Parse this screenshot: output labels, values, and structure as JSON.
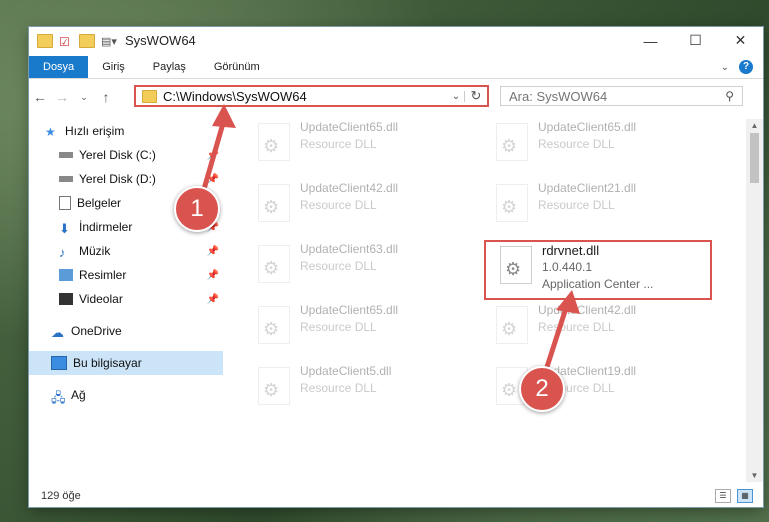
{
  "window": {
    "title": "SysWOW64"
  },
  "ribbon": {
    "tabs": [
      "Dosya",
      "Giriş",
      "Paylaş",
      "Görünüm"
    ]
  },
  "address": {
    "path": "C:\\Windows\\SysWOW64"
  },
  "search": {
    "placeholder": "Ara: SysWOW64"
  },
  "sidebar": {
    "items": [
      {
        "label": "Hızlı erişim",
        "icon": "star-icon"
      },
      {
        "label": "Yerel Disk (C:)",
        "icon": "drive-icon",
        "pinned": true
      },
      {
        "label": "Yerel Disk (D:)",
        "icon": "drive-icon",
        "pinned": true
      },
      {
        "label": "Belgeler",
        "icon": "document-icon",
        "pinned": true
      },
      {
        "label": "İndirmeler",
        "icon": "download-icon",
        "pinned": true
      },
      {
        "label": "Müzik",
        "icon": "music-icon",
        "pinned": true
      },
      {
        "label": "Resimler",
        "icon": "picture-icon",
        "pinned": true
      },
      {
        "label": "Videolar",
        "icon": "video-icon",
        "pinned": true
      },
      {
        "label": "OneDrive",
        "icon": "cloud-icon"
      },
      {
        "label": "Bu bilgisayar",
        "icon": "computer-icon",
        "selected": true
      },
      {
        "label": "Ağ",
        "icon": "network-icon"
      }
    ]
  },
  "files": [
    {
      "name": "UpdateClient65.dll",
      "sub": "Resource DLL"
    },
    {
      "name": "UpdateClient65.dll",
      "sub": "Resource DLL"
    },
    {
      "name": "UpdateClient42.dll",
      "sub": "Resource DLL"
    },
    {
      "name": "UpdateClient21.dll",
      "sub": "Resource DLL"
    },
    {
      "name": "UpdateClient63.dll",
      "sub": "Resource DLL"
    },
    {
      "name": "rdrvnet.dll",
      "version": "1.0.440.1",
      "sub": "Application Center ..."
    },
    {
      "name": "UpdateClient65.dll",
      "sub": "Resource DLL"
    },
    {
      "name": "UpdateClient42.dll",
      "sub": "Resource DLL"
    },
    {
      "name": "UpdateClient5.dll",
      "sub": "Resource DLL"
    },
    {
      "name": "UpdateClient19.dll",
      "sub": "Resource DLL"
    }
  ],
  "status": {
    "count": "129 öğe"
  },
  "annotations": [
    "1",
    "2"
  ],
  "colors": {
    "accent": "#1979ca",
    "highlight": "#d9534f"
  }
}
